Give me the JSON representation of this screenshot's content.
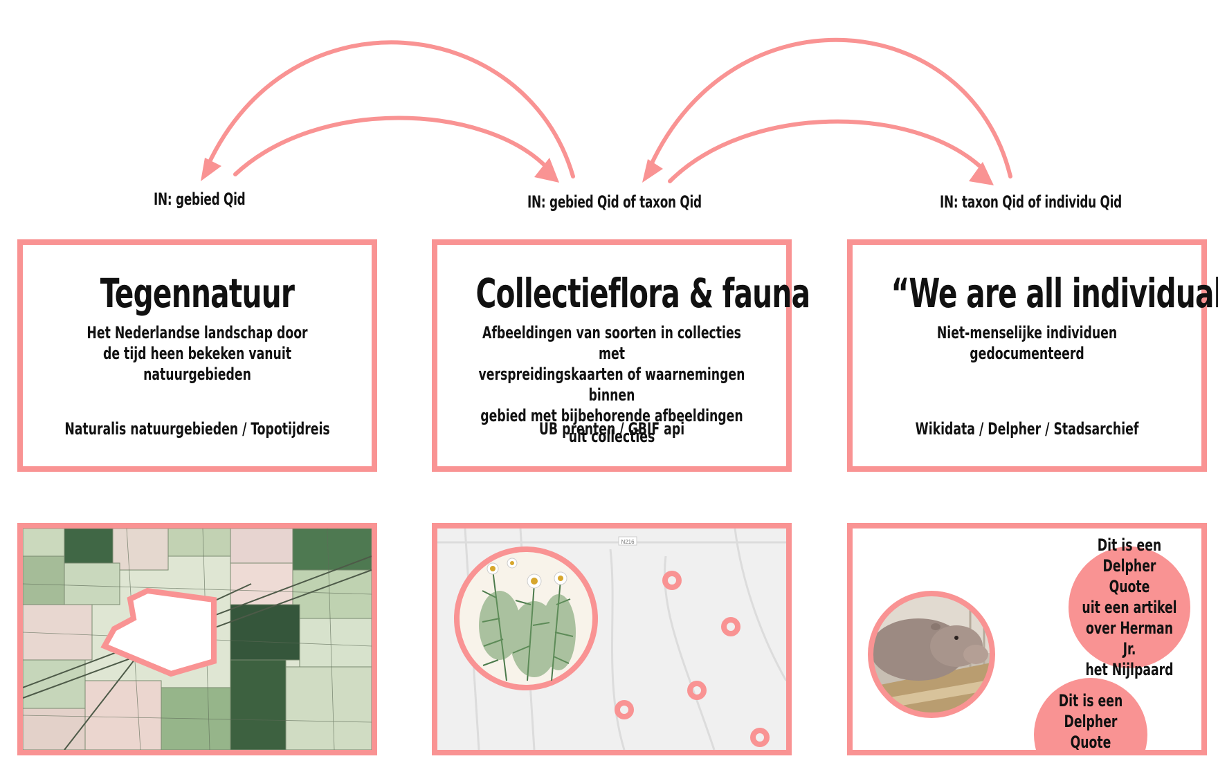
{
  "colors": {
    "accent": "#f99393",
    "text": "#111111"
  },
  "inputs": [
    {
      "label": "IN: gebied Qid"
    },
    {
      "label": "IN: gebied Qid of taxon Qid"
    },
    {
      "label": "IN: taxon Qid of individu Qid"
    }
  ],
  "cards": [
    {
      "title": "Tegennatuur",
      "description": "Het Nederlandse landschap door\nde tijd heen bekeken vanuit\nnatuurgebieden",
      "sources": "Naturalis natuurgebieden / Topotijdreis"
    },
    {
      "title": "Collectieflora & fauna",
      "description": "Afbeeldingen van soorten in collecties met\nverspreidingskaarten of waarnemingen binnen\ngebied met bijbehorende afbeeldingen uit collecties",
      "sources": "UB prenten / GBIF api"
    },
    {
      "title": "“We are all individuals”",
      "description": "Niet-menselijke individuen\ngedocumenteerd",
      "sources": "Wikidata / Delpher / Stadsarchief"
    }
  ],
  "panels": {
    "map_label": "N216",
    "quotes": [
      "Dit is een\nDelpher Quote\nuit een artikel\nover Herman Jr.\nhet Nijlpaard",
      "Dit is een\nDelpher Quote\nuit een artikel"
    ]
  }
}
